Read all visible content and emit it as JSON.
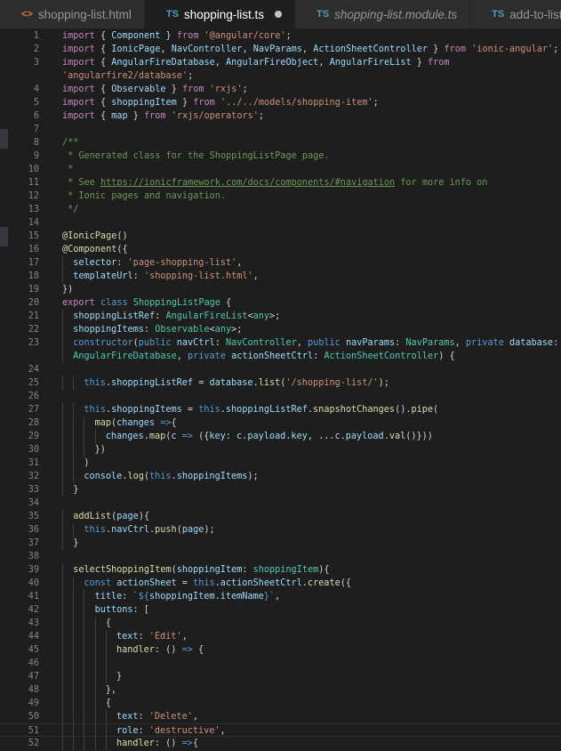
{
  "tabs": [
    {
      "icon": "<>",
      "icon_kind": "html",
      "label": "shopping-list.html",
      "active": false,
      "italic": false,
      "modified": false
    },
    {
      "icon": "TS",
      "icon_kind": "ts",
      "label": "shopping-list.ts",
      "active": true,
      "italic": false,
      "modified": true
    },
    {
      "icon": "TS",
      "icon_kind": "ts",
      "label": "shopping-list.module.ts",
      "active": false,
      "italic": true,
      "modified": false
    },
    {
      "icon": "TS",
      "icon_kind": "ts",
      "label": "add-to-list.ts",
      "active": false,
      "italic": false,
      "modified": false
    }
  ],
  "colors": {
    "keyword": "#569cd6",
    "control": "#c586c0",
    "string": "#ce9178",
    "class": "#4ec9b0",
    "function": "#dcdcaa",
    "variable": "#9cdcfe",
    "comment": "#6a9955",
    "text": "#d4d4d4",
    "line_number": "#858585",
    "background": "#1e1e1e"
  },
  "lines": [
    {
      "n": "1",
      "t": [
        [
          "ctl",
          "import"
        ],
        [
          "pl",
          " { "
        ],
        [
          "var",
          "Component"
        ],
        [
          "pl",
          " } "
        ],
        [
          "ctl",
          "from"
        ],
        [
          "pl",
          " "
        ],
        [
          "str",
          "'@angular/core'"
        ],
        [
          "pl",
          ";"
        ]
      ]
    },
    {
      "n": "2",
      "t": [
        [
          "ctl",
          "import"
        ],
        [
          "pl",
          " { "
        ],
        [
          "var",
          "IonicPage"
        ],
        [
          "pl",
          ", "
        ],
        [
          "var",
          "NavController"
        ],
        [
          "pl",
          ", "
        ],
        [
          "var",
          "NavParams"
        ],
        [
          "pl",
          ", "
        ],
        [
          "var",
          "ActionSheetController"
        ],
        [
          "pl",
          " } "
        ],
        [
          "ctl",
          "from"
        ],
        [
          "pl",
          " "
        ],
        [
          "str",
          "'ionic-angular'"
        ],
        [
          "pl",
          ";"
        ]
      ]
    },
    {
      "n": "3",
      "t": [
        [
          "ctl",
          "import"
        ],
        [
          "pl",
          " { "
        ],
        [
          "var",
          "AngularFireDatabase"
        ],
        [
          "pl",
          ", "
        ],
        [
          "var",
          "AngularFireObject"
        ],
        [
          "pl",
          ", "
        ],
        [
          "var",
          "AngularFireList"
        ],
        [
          "pl",
          " } "
        ],
        [
          "ctl",
          "from"
        ]
      ]
    },
    {
      "n": "",
      "t": [
        [
          "str",
          "'angularfire2/database'"
        ],
        [
          "pl",
          ";"
        ]
      ]
    },
    {
      "n": "4",
      "t": [
        [
          "ctl",
          "import"
        ],
        [
          "pl",
          " { "
        ],
        [
          "var",
          "Observable"
        ],
        [
          "pl",
          " } "
        ],
        [
          "ctl",
          "from"
        ],
        [
          "pl",
          " "
        ],
        [
          "str",
          "'rxjs'"
        ],
        [
          "pl",
          ";"
        ]
      ]
    },
    {
      "n": "5",
      "t": [
        [
          "ctl",
          "import"
        ],
        [
          "pl",
          " { "
        ],
        [
          "var",
          "shoppingItem"
        ],
        [
          "pl",
          " } "
        ],
        [
          "ctl",
          "from"
        ],
        [
          "pl",
          " "
        ],
        [
          "str",
          "'../../models/shopping-item'"
        ],
        [
          "pl",
          ";"
        ]
      ]
    },
    {
      "n": "6",
      "t": [
        [
          "ctl",
          "import"
        ],
        [
          "pl",
          " { "
        ],
        [
          "var",
          "map"
        ],
        [
          "pl",
          " } "
        ],
        [
          "ctl",
          "from"
        ],
        [
          "pl",
          " "
        ],
        [
          "str",
          "'rxjs/operators'"
        ],
        [
          "pl",
          ";"
        ]
      ]
    },
    {
      "n": "7",
      "t": []
    },
    {
      "n": "8",
      "t": [
        [
          "cm",
          "/**"
        ]
      ]
    },
    {
      "n": "9",
      "t": [
        [
          "cm",
          " * Generated class for the ShoppingListPage page."
        ]
      ]
    },
    {
      "n": "10",
      "t": [
        [
          "cm",
          " *"
        ]
      ]
    },
    {
      "n": "11",
      "t": [
        [
          "cm",
          " * See "
        ],
        [
          "link",
          "https://ionicframework.com/docs/components/#navigation"
        ],
        [
          "cm",
          " for more info on"
        ]
      ]
    },
    {
      "n": "12",
      "t": [
        [
          "cm",
          " * Ionic pages and navigation."
        ]
      ]
    },
    {
      "n": "13",
      "t": [
        [
          "cm",
          " */"
        ]
      ]
    },
    {
      "n": "14",
      "t": []
    },
    {
      "n": "15",
      "t": [
        [
          "fn",
          "@IonicPage"
        ],
        [
          "pl",
          "()"
        ]
      ]
    },
    {
      "n": "16",
      "t": [
        [
          "fn",
          "@Component"
        ],
        [
          "pl",
          "({"
        ]
      ]
    },
    {
      "n": "17",
      "i": 1,
      "t": [
        [
          "var",
          "selector"
        ],
        [
          "pl",
          ": "
        ],
        [
          "str",
          "'page-shopping-list'"
        ],
        [
          "pl",
          ","
        ]
      ]
    },
    {
      "n": "18",
      "i": 1,
      "t": [
        [
          "var",
          "templateUrl"
        ],
        [
          "pl",
          ": "
        ],
        [
          "str",
          "'shopping-list.html'"
        ],
        [
          "pl",
          ","
        ]
      ]
    },
    {
      "n": "19",
      "t": [
        [
          "pl",
          "})"
        ]
      ]
    },
    {
      "n": "20",
      "t": [
        [
          "ctl",
          "export"
        ],
        [
          "pl",
          " "
        ],
        [
          "kw",
          "class"
        ],
        [
          "pl",
          " "
        ],
        [
          "cls",
          "ShoppingListPage"
        ],
        [
          "pl",
          " {"
        ]
      ]
    },
    {
      "n": "21",
      "i": 1,
      "t": [
        [
          "var",
          "shoppingListRef"
        ],
        [
          "pl",
          ": "
        ],
        [
          "cls",
          "AngularFireList"
        ],
        [
          "pl",
          "<"
        ],
        [
          "cls",
          "any"
        ],
        [
          "pl",
          ">;"
        ]
      ]
    },
    {
      "n": "22",
      "i": 1,
      "t": [
        [
          "var",
          "shoppingItems"
        ],
        [
          "pl",
          ": "
        ],
        [
          "cls",
          "Observable"
        ],
        [
          "pl",
          "<"
        ],
        [
          "cls",
          "any"
        ],
        [
          "pl",
          ">;"
        ]
      ]
    },
    {
      "n": "23",
      "i": 1,
      "t": [
        [
          "kw",
          "constructor"
        ],
        [
          "pl",
          "("
        ],
        [
          "kw",
          "public"
        ],
        [
          "pl",
          " "
        ],
        [
          "var",
          "navCtrl"
        ],
        [
          "pl",
          ": "
        ],
        [
          "cls",
          "NavController"
        ],
        [
          "pl",
          ", "
        ],
        [
          "kw",
          "public"
        ],
        [
          "pl",
          " "
        ],
        [
          "var",
          "navParams"
        ],
        [
          "pl",
          ": "
        ],
        [
          "cls",
          "NavParams"
        ],
        [
          "pl",
          ", "
        ],
        [
          "kw",
          "private"
        ],
        [
          "pl",
          " "
        ],
        [
          "var",
          "database"
        ],
        [
          "pl",
          ":"
        ]
      ]
    },
    {
      "n": "",
      "i": 1,
      "t": [
        [
          "cls",
          "AngularFireDatabase"
        ],
        [
          "pl",
          ", "
        ],
        [
          "kw",
          "private"
        ],
        [
          "pl",
          " "
        ],
        [
          "var",
          "actionSheetCtrl"
        ],
        [
          "pl",
          ": "
        ],
        [
          "cls",
          "ActionSheetController"
        ],
        [
          "pl",
          ") {"
        ]
      ]
    },
    {
      "n": "24",
      "t": []
    },
    {
      "n": "25",
      "i": 2,
      "t": [
        [
          "kw",
          "this"
        ],
        [
          "pl",
          "."
        ],
        [
          "var",
          "shoppingListRef"
        ],
        [
          "pl",
          " = "
        ],
        [
          "var",
          "database"
        ],
        [
          "pl",
          "."
        ],
        [
          "fn",
          "list"
        ],
        [
          "pl",
          "("
        ],
        [
          "str",
          "'/shopping-list/'"
        ],
        [
          "pl",
          ");"
        ]
      ]
    },
    {
      "n": "26",
      "t": []
    },
    {
      "n": "27",
      "i": 2,
      "t": [
        [
          "kw",
          "this"
        ],
        [
          "pl",
          "."
        ],
        [
          "var",
          "shoppingItems"
        ],
        [
          "pl",
          " = "
        ],
        [
          "kw",
          "this"
        ],
        [
          "pl",
          "."
        ],
        [
          "var",
          "shoppingListRef"
        ],
        [
          "pl",
          "."
        ],
        [
          "fn",
          "snapshotChanges"
        ],
        [
          "pl",
          "()."
        ],
        [
          "fn",
          "pipe"
        ],
        [
          "pl",
          "("
        ]
      ]
    },
    {
      "n": "28",
      "i": 3,
      "t": [
        [
          "fn",
          "map"
        ],
        [
          "pl",
          "("
        ],
        [
          "var",
          "changes"
        ],
        [
          "pl",
          " "
        ],
        [
          "kw",
          "=>"
        ],
        [
          "pl",
          "{"
        ]
      ]
    },
    {
      "n": "29",
      "i": 4,
      "t": [
        [
          "var",
          "changes"
        ],
        [
          "pl",
          "."
        ],
        [
          "fn",
          "map"
        ],
        [
          "pl",
          "("
        ],
        [
          "var",
          "c"
        ],
        [
          "pl",
          " "
        ],
        [
          "kw",
          "=>"
        ],
        [
          "pl",
          " ({"
        ],
        [
          "var",
          "key"
        ],
        [
          "pl",
          ": "
        ],
        [
          "var",
          "c"
        ],
        [
          "pl",
          "."
        ],
        [
          "var",
          "payload"
        ],
        [
          "pl",
          "."
        ],
        [
          "var",
          "key"
        ],
        [
          "pl",
          ", ..."
        ],
        [
          "var",
          "c"
        ],
        [
          "pl",
          "."
        ],
        [
          "var",
          "payload"
        ],
        [
          "pl",
          "."
        ],
        [
          "fn",
          "val"
        ],
        [
          "pl",
          "()}))"
        ]
      ]
    },
    {
      "n": "30",
      "i": 3,
      "t": [
        [
          "pl",
          "})"
        ]
      ]
    },
    {
      "n": "31",
      "i": 2,
      "t": [
        [
          "pl",
          ")"
        ]
      ]
    },
    {
      "n": "32",
      "i": 2,
      "t": [
        [
          "var",
          "console"
        ],
        [
          "pl",
          "."
        ],
        [
          "fn",
          "log"
        ],
        [
          "pl",
          "("
        ],
        [
          "kw",
          "this"
        ],
        [
          "pl",
          "."
        ],
        [
          "var",
          "shoppingItems"
        ],
        [
          "pl",
          ");"
        ]
      ]
    },
    {
      "n": "33",
      "i": 1,
      "t": [
        [
          "pl",
          "}"
        ]
      ]
    },
    {
      "n": "34",
      "t": []
    },
    {
      "n": "35",
      "i": 1,
      "t": [
        [
          "fn",
          "addList"
        ],
        [
          "pl",
          "("
        ],
        [
          "var",
          "page"
        ],
        [
          "pl",
          "){"
        ]
      ]
    },
    {
      "n": "36",
      "i": 2,
      "t": [
        [
          "kw",
          "this"
        ],
        [
          "pl",
          "."
        ],
        [
          "var",
          "navCtrl"
        ],
        [
          "pl",
          "."
        ],
        [
          "fn",
          "push"
        ],
        [
          "pl",
          "("
        ],
        [
          "var",
          "page"
        ],
        [
          "pl",
          ");"
        ]
      ]
    },
    {
      "n": "37",
      "i": 1,
      "t": [
        [
          "pl",
          "}"
        ]
      ]
    },
    {
      "n": "38",
      "t": []
    },
    {
      "n": "39",
      "i": 1,
      "t": [
        [
          "fn",
          "selectShoppingItem"
        ],
        [
          "pl",
          "("
        ],
        [
          "var",
          "shoppingItem"
        ],
        [
          "pl",
          ": "
        ],
        [
          "cls",
          "shoppingItem"
        ],
        [
          "pl",
          "){"
        ]
      ]
    },
    {
      "n": "40",
      "i": 2,
      "t": [
        [
          "kw",
          "const"
        ],
        [
          "pl",
          " "
        ],
        [
          "var",
          "actionSheet"
        ],
        [
          "pl",
          " = "
        ],
        [
          "kw",
          "this"
        ],
        [
          "pl",
          "."
        ],
        [
          "var",
          "actionSheetCtrl"
        ],
        [
          "pl",
          "."
        ],
        [
          "fn",
          "create"
        ],
        [
          "pl",
          "({"
        ]
      ]
    },
    {
      "n": "41",
      "i": 3,
      "t": [
        [
          "var",
          "title"
        ],
        [
          "pl",
          ": "
        ],
        [
          "str",
          "`"
        ],
        [
          "kw",
          "${"
        ],
        [
          "var",
          "shoppingItem"
        ],
        [
          "pl",
          "."
        ],
        [
          "var",
          "itemName"
        ],
        [
          "kw",
          "}"
        ],
        [
          "str",
          "`"
        ],
        [
          "pl",
          ","
        ]
      ]
    },
    {
      "n": "42",
      "i": 3,
      "t": [
        [
          "var",
          "buttons"
        ],
        [
          "pl",
          ": ["
        ]
      ]
    },
    {
      "n": "43",
      "i": 4,
      "t": [
        [
          "pl",
          "{"
        ]
      ]
    },
    {
      "n": "44",
      "i": 5,
      "t": [
        [
          "var",
          "text"
        ],
        [
          "pl",
          ": "
        ],
        [
          "str",
          "'Edit'"
        ],
        [
          "pl",
          ","
        ]
      ]
    },
    {
      "n": "45",
      "i": 5,
      "t": [
        [
          "fn",
          "handler"
        ],
        [
          "pl",
          ": () "
        ],
        [
          "kw",
          "=>"
        ],
        [
          "pl",
          " {"
        ]
      ]
    },
    {
      "n": "46",
      "i": 5,
      "t": []
    },
    {
      "n": "47",
      "i": 5,
      "t": [
        [
          "pl",
          "}"
        ]
      ]
    },
    {
      "n": "48",
      "i": 4,
      "t": [
        [
          "pl",
          "},"
        ]
      ]
    },
    {
      "n": "49",
      "i": 4,
      "t": [
        [
          "pl",
          "{"
        ]
      ]
    },
    {
      "n": "50",
      "i": 5,
      "t": [
        [
          "var",
          "text"
        ],
        [
          "pl",
          ": "
        ],
        [
          "str",
          "'Delete'"
        ],
        [
          "pl",
          ","
        ]
      ]
    },
    {
      "n": "51",
      "i": 5,
      "cur": true,
      "t": [
        [
          "var",
          "role"
        ],
        [
          "pl",
          ": "
        ],
        [
          "str",
          "'destructive'"
        ],
        [
          "pl",
          ","
        ]
      ]
    },
    {
      "n": "52",
      "i": 5,
      "t": [
        [
          "fn",
          "handler"
        ],
        [
          "pl",
          ": () "
        ],
        [
          "kw",
          "=>"
        ],
        [
          "pl",
          "{"
        ]
      ]
    }
  ]
}
